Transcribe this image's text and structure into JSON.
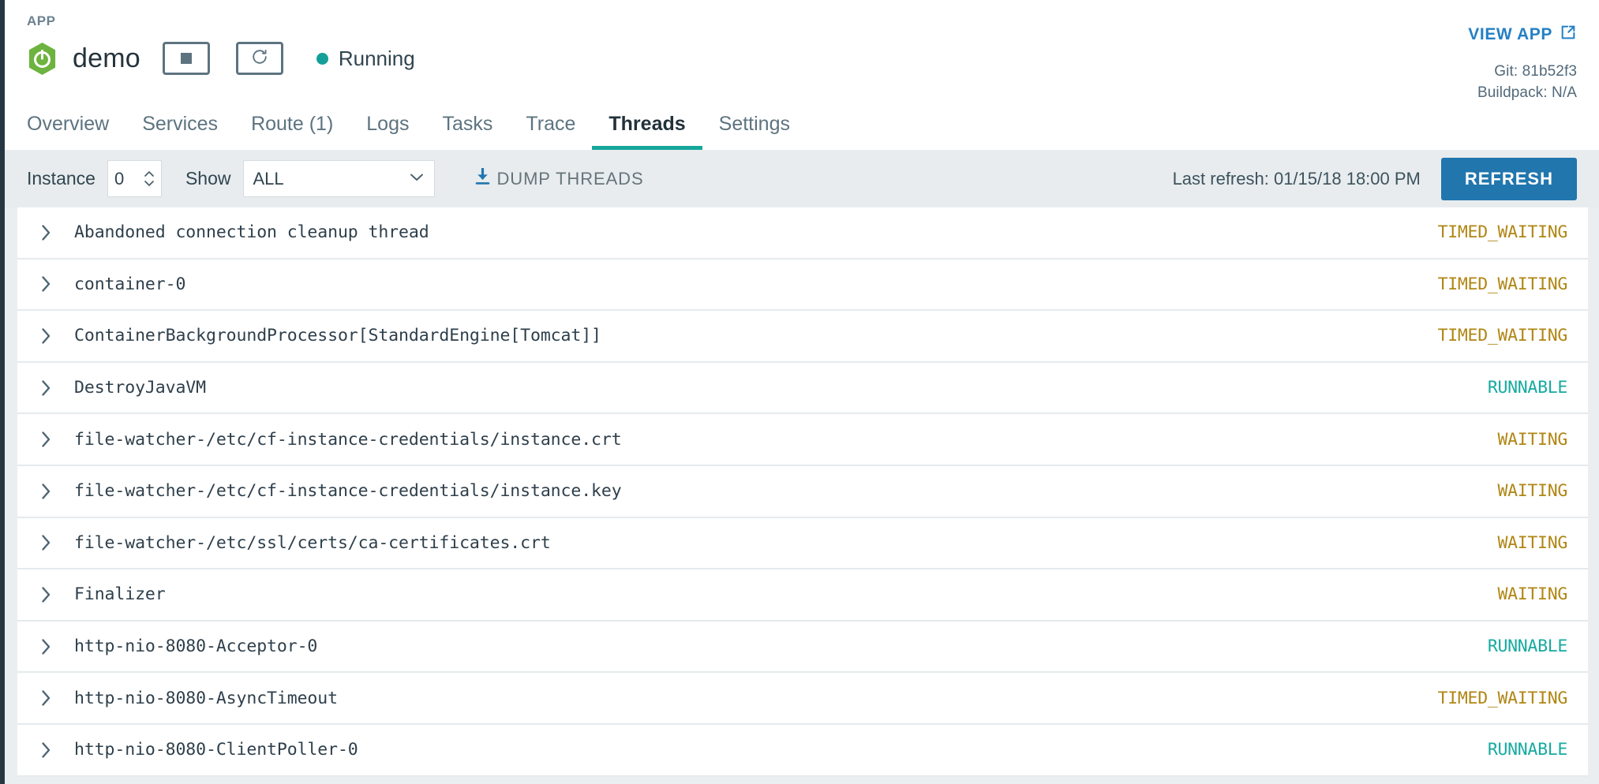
{
  "left_rail": {
    "present": true
  },
  "header": {
    "kicker": "APP",
    "app_name": "demo",
    "logo_icon": "spring-boot-logo",
    "stop_button": {
      "icon": "stop-square-icon",
      "label": "Stop"
    },
    "restart_button": {
      "icon": "restart-icon",
      "label": "Restart"
    },
    "status": {
      "label": "Running",
      "dot_color": "#14a098"
    },
    "view_app": {
      "label": "VIEW APP",
      "icon": "external-link-icon",
      "color": "#2480c4"
    },
    "git": "Git: 81b52f3",
    "buildpack": "Buildpack: N/A"
  },
  "tabs": [
    {
      "label": "Overview",
      "active": false
    },
    {
      "label": "Services",
      "active": false
    },
    {
      "label": "Route (1)",
      "active": false
    },
    {
      "label": "Logs",
      "active": false
    },
    {
      "label": "Tasks",
      "active": false
    },
    {
      "label": "Trace",
      "active": false
    },
    {
      "label": "Threads",
      "active": true
    },
    {
      "label": "Settings",
      "active": false
    }
  ],
  "toolbar": {
    "instance_label": "Instance",
    "instance_value": "0",
    "show_label": "Show",
    "show_value": "ALL",
    "show_options": [
      "ALL"
    ],
    "dump_threads_label": "DUMP THREADS",
    "dump_threads_icon": "download-icon",
    "last_refresh": "Last refresh: 01/15/18 18:00 PM",
    "refresh_label": "REFRESH",
    "refresh_color": "#2176ae"
  },
  "threads": {
    "expand_icon": "chevron-right-icon",
    "state_colors": {
      "TIMED_WAITING": "#b08614",
      "WAITING": "#b08614",
      "RUNNABLE": "#17aaa0"
    },
    "rows": [
      {
        "name": "Abandoned connection cleanup thread",
        "state": "TIMED_WAITING"
      },
      {
        "name": "container-0",
        "state": "TIMED_WAITING"
      },
      {
        "name": "ContainerBackgroundProcessor[StandardEngine[Tomcat]]",
        "state": "TIMED_WAITING"
      },
      {
        "name": "DestroyJavaVM",
        "state": "RUNNABLE"
      },
      {
        "name": "file-watcher-/etc/cf-instance-credentials/instance.crt",
        "state": "WAITING"
      },
      {
        "name": "file-watcher-/etc/cf-instance-credentials/instance.key",
        "state": "WAITING"
      },
      {
        "name": "file-watcher-/etc/ssl/certs/ca-certificates.crt",
        "state": "WAITING"
      },
      {
        "name": "Finalizer",
        "state": "WAITING"
      },
      {
        "name": "http-nio-8080-Acceptor-0",
        "state": "RUNNABLE"
      },
      {
        "name": "http-nio-8080-AsyncTimeout",
        "state": "TIMED_WAITING"
      },
      {
        "name": "http-nio-8080-ClientPoller-0",
        "state": "RUNNABLE"
      }
    ]
  }
}
